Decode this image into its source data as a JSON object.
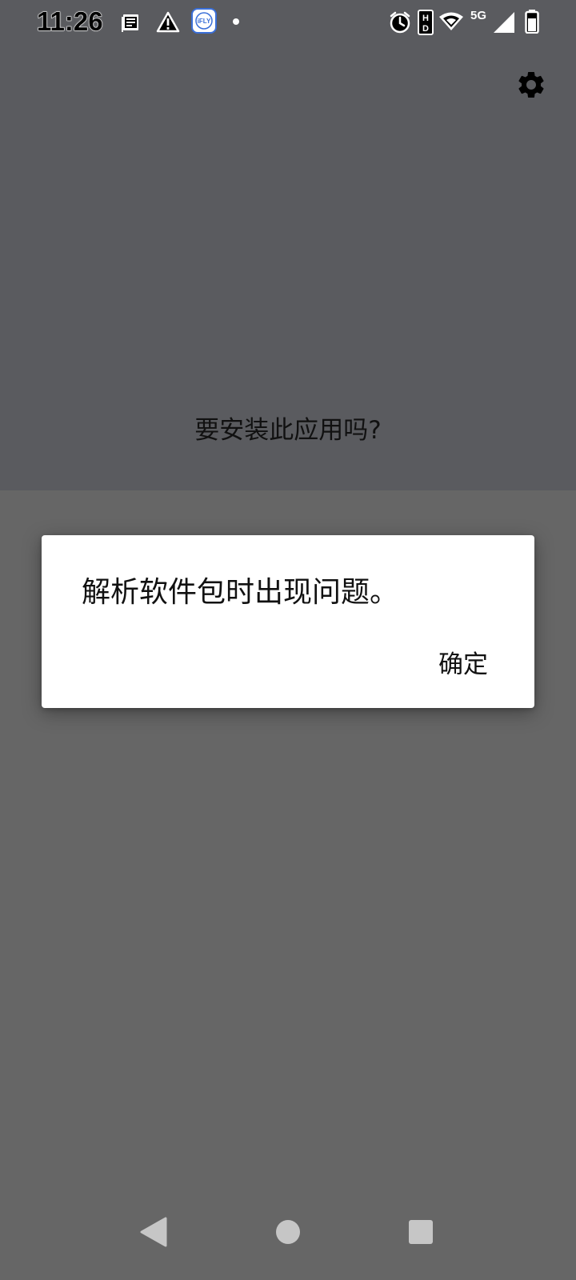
{
  "status_bar": {
    "time": "11:26",
    "notification_icons": [
      "notes-icon",
      "warning-icon",
      "ifly-app-icon",
      "dot-icon"
    ],
    "ifly_label": "iFLY",
    "network_label": "5G",
    "system_icons": [
      "alarm-icon",
      "hd-icon",
      "wifi-icon",
      "signal-icon",
      "battery-icon"
    ]
  },
  "header": {
    "settings_icon": "gear-icon"
  },
  "install": {
    "question": "要安装此应用吗?"
  },
  "dialog": {
    "message": "解析软件包时出现问题。",
    "ok_label": "确定"
  },
  "nav_bar": {
    "icons": [
      "back-icon",
      "home-icon",
      "recents-icon"
    ]
  },
  "colors": {
    "top_background": "#5a5b5f",
    "bottom_background": "#666666",
    "dialog_background": "#ffffff",
    "nav_icon": "#c6c6c6"
  }
}
